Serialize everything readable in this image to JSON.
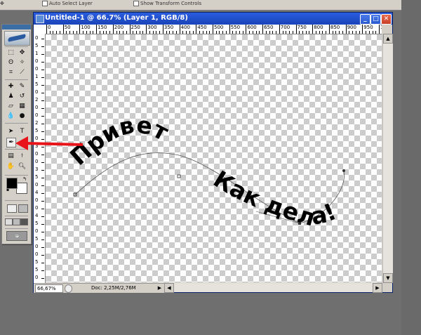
{
  "options_bar": {
    "auto_select_label": "Auto Select Layer",
    "show_transform_label": "Show Transform Controls"
  },
  "document": {
    "title": "Untitled-1 @ 66.7% (Layer 1, RGB/8)",
    "ruler_labels": [
      "0",
      "50",
      "100",
      "150",
      "200",
      "250",
      "300",
      "350",
      "400",
      "450",
      "500",
      "550",
      "600",
      "650",
      "700",
      "750",
      "800",
      "850",
      "900",
      "950",
      "1000"
    ],
    "vruler_labels": [
      "0",
      "5",
      "1",
      "0",
      "0",
      "1",
      "5",
      "0",
      "2",
      "0",
      "0",
      "2",
      "5",
      "0",
      "3",
      "0",
      "0",
      "3",
      "5",
      "0",
      "4",
      "0",
      "0",
      "4",
      "5",
      "0",
      "5",
      "0",
      "0",
      "5",
      "5",
      "0"
    ],
    "text_on_path": {
      "word1": "Привет",
      "word2": "Как дела!",
      "color": "#000000"
    }
  },
  "status_bar": {
    "zoom": "66,67%",
    "doc_info": "Doc: 2,25M/2,76M"
  },
  "window_buttons": {
    "minimize": "_",
    "maximize": "□",
    "close": "✕"
  },
  "annotation": {
    "arrow_color": "#e8141a",
    "points_to": "pen-tool"
  },
  "colors": {
    "title_bar": "#2a5de0",
    "foreground_swatch": "#000000",
    "background_swatch": "#ffffff"
  }
}
